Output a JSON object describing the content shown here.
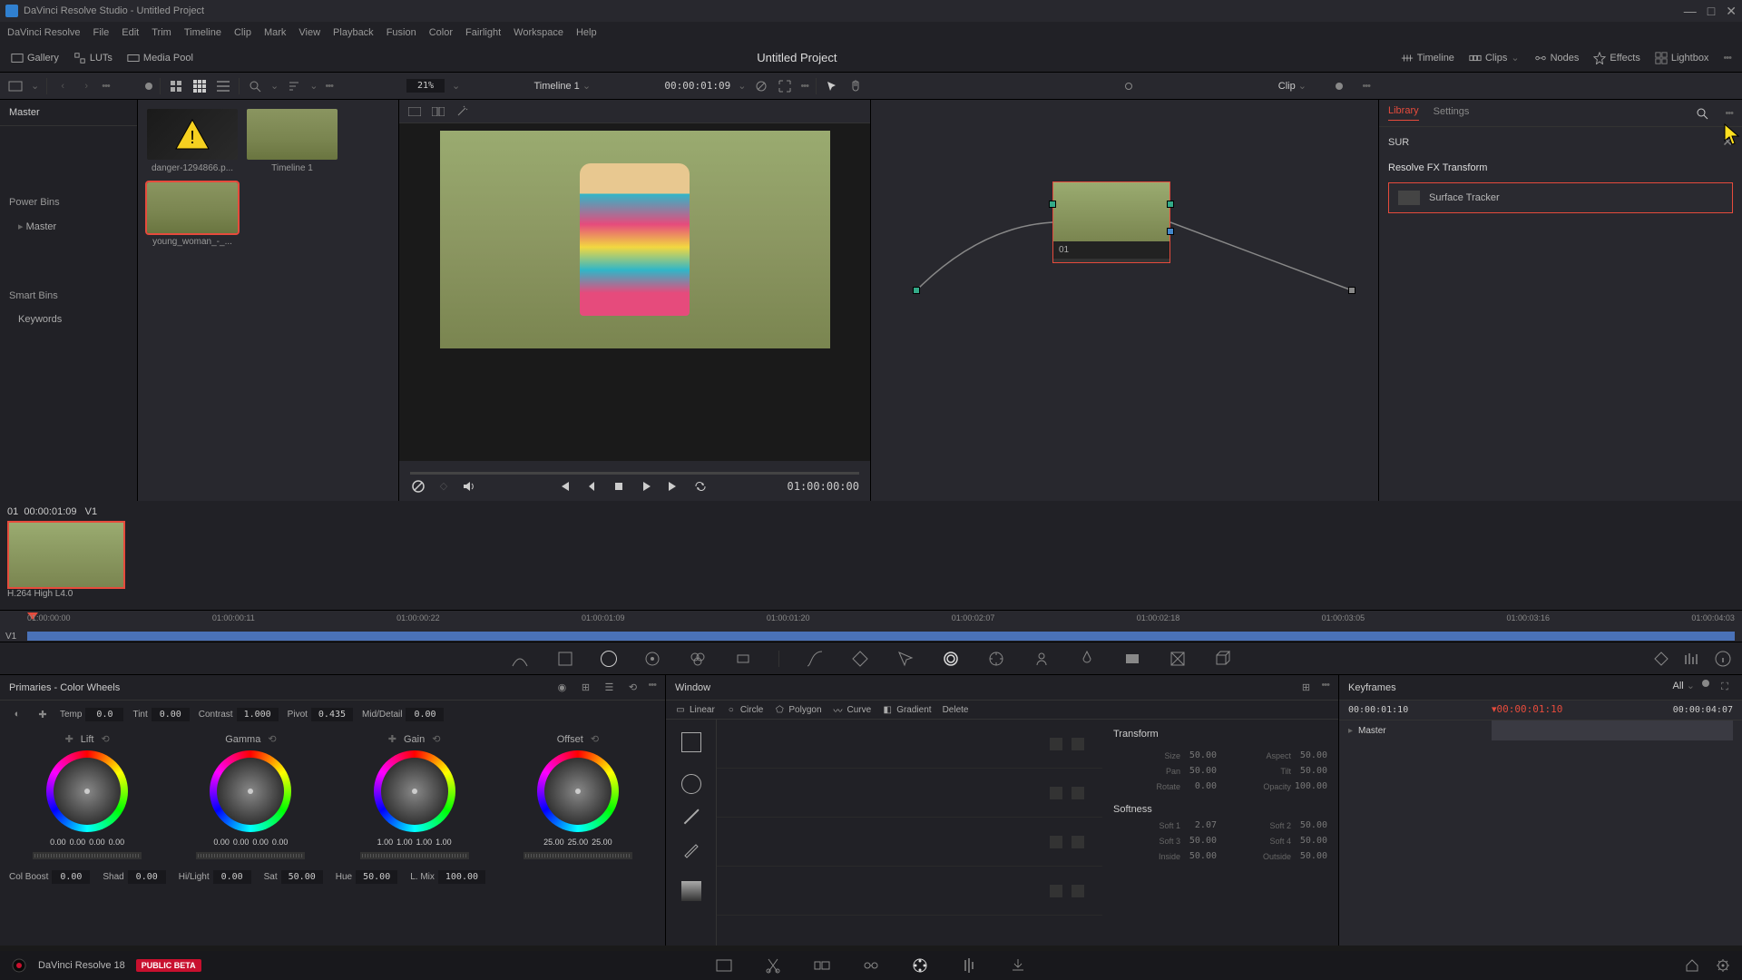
{
  "titlebar": {
    "title": "DaVinci Resolve Studio - Untitled Project"
  },
  "menubar": [
    "DaVinci Resolve",
    "File",
    "Edit",
    "Trim",
    "Timeline",
    "Clip",
    "Mark",
    "View",
    "Playback",
    "Fusion",
    "Color",
    "Fairlight",
    "Workspace",
    "Help"
  ],
  "toolbar": {
    "gallery": "Gallery",
    "luts": "LUTs",
    "media_pool": "Media Pool",
    "project_title": "Untitled Project",
    "timeline": "Timeline",
    "clips": "Clips",
    "nodes": "Nodes",
    "effects": "Effects",
    "lightbox": "Lightbox"
  },
  "subtoolbar": {
    "zoom_pct": "21%",
    "timeline_name": "Timeline 1",
    "timeline_tc": "00:00:01:09",
    "clip_label": "Clip"
  },
  "media_sidebar": {
    "master": "Master",
    "power_bins": "Power Bins",
    "master_item": "Master",
    "smart_bins": "Smart Bins",
    "keywords": "Keywords"
  },
  "media_pool": {
    "thumbs": [
      {
        "label": "danger-1294866.p..."
      },
      {
        "label": "Timeline 1"
      },
      {
        "label": "young_woman_-_..."
      }
    ]
  },
  "viewer": {
    "tc": "01:00:00:00"
  },
  "node": {
    "label": "01"
  },
  "fx": {
    "library_tab": "Library",
    "settings_tab": "Settings",
    "search_value": "SUR",
    "group_title": "Resolve FX Transform",
    "item": "Surface Tracker"
  },
  "clip_row": {
    "index": "01",
    "tc": "00:00:01:09",
    "track": "V1",
    "codec": "H.264 High L4.0"
  },
  "ruler": [
    "01:00:00:00",
    "01:00:00:11",
    "01:00:00:22",
    "01:00:01:09",
    "01:00:01:20",
    "01:00:02:07",
    "01:00:02:18",
    "01:00:03:05",
    "01:00:03:16",
    "01:00:04:03"
  ],
  "ruler_track": "V1",
  "primaries": {
    "title": "Primaries - Color Wheels",
    "temp": {
      "label": "Temp",
      "val": "0.0"
    },
    "tint": {
      "label": "Tint",
      "val": "0.00"
    },
    "contrast": {
      "label": "Contrast",
      "val": "1.000"
    },
    "pivot": {
      "label": "Pivot",
      "val": "0.435"
    },
    "middetail": {
      "label": "Mid/Detail",
      "val": "0.00"
    },
    "wheels": {
      "lift": {
        "title": "Lift",
        "vals": [
          "0.00",
          "0.00",
          "0.00",
          "0.00"
        ]
      },
      "gamma": {
        "title": "Gamma",
        "vals": [
          "0.00",
          "0.00",
          "0.00",
          "0.00"
        ]
      },
      "gain": {
        "title": "Gain",
        "vals": [
          "1.00",
          "1.00",
          "1.00",
          "1.00"
        ]
      },
      "offset": {
        "title": "Offset",
        "vals": [
          "25.00",
          "25.00",
          "25.00"
        ]
      }
    },
    "bottom": {
      "colboost": {
        "label": "Col Boost",
        "val": "0.00"
      },
      "shad": {
        "label": "Shad",
        "val": "0.00"
      },
      "hilight": {
        "label": "Hi/Light",
        "val": "0.00"
      },
      "sat": {
        "label": "Sat",
        "val": "50.00"
      },
      "hue": {
        "label": "Hue",
        "val": "50.00"
      },
      "lmix": {
        "label": "L. Mix",
        "val": "100.00"
      }
    }
  },
  "window": {
    "title": "Window",
    "tools": {
      "linear": "Linear",
      "circle": "Circle",
      "polygon": "Polygon",
      "curve": "Curve",
      "gradient": "Gradient",
      "delete": "Delete"
    },
    "transform_title": "Transform",
    "size": {
      "label": "Size",
      "val": "50.00"
    },
    "aspect": {
      "label": "Aspect",
      "val": "50.00"
    },
    "pan": {
      "label": "Pan",
      "val": "50.00"
    },
    "tilt": {
      "label": "Tilt",
      "val": "50.00"
    },
    "rotate": {
      "label": "Rotate",
      "val": "0.00"
    },
    "opacity": {
      "label": "Opacity",
      "val": "100.00"
    },
    "softness_title": "Softness",
    "soft1": {
      "label": "Soft 1",
      "val": "2.07"
    },
    "soft2": {
      "label": "Soft 2",
      "val": "50.00"
    },
    "soft3": {
      "label": "Soft 3",
      "val": "50.00"
    },
    "soft4": {
      "label": "Soft 4",
      "val": "50.00"
    },
    "inside": {
      "label": "Inside",
      "val": "50.00"
    },
    "outside": {
      "label": "Outside",
      "val": "50.00"
    }
  },
  "keyframes": {
    "title": "Keyframes",
    "all": "All",
    "tc_left": "00:00:01:10",
    "tc_play": "00:00:01:10",
    "tc_right": "00:00:04:07",
    "master": "Master"
  },
  "statusbar": {
    "app": "DaVinci Resolve 18",
    "beta": "PUBLIC BETA"
  }
}
